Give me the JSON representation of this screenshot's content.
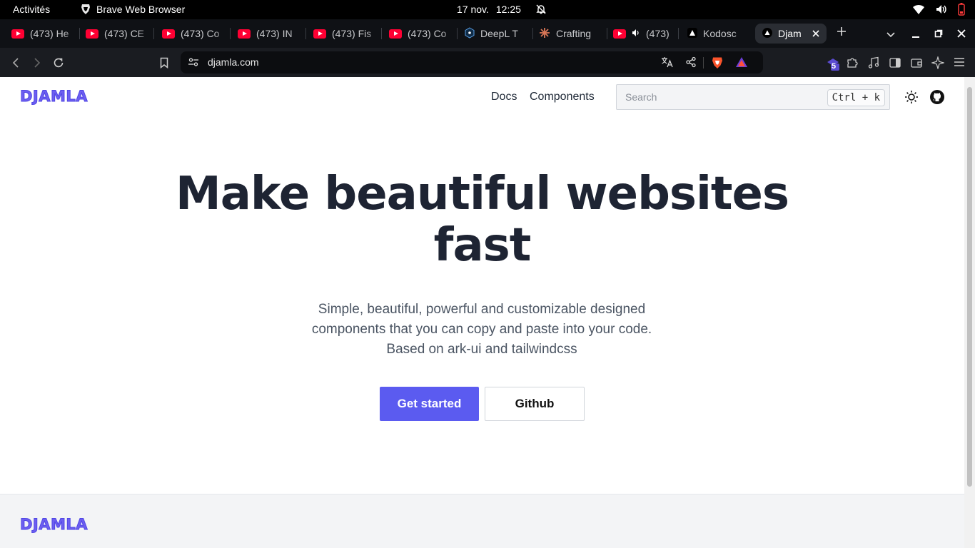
{
  "system_bar": {
    "activities": "Activités",
    "app_name": "Brave Web Browser",
    "date": "17 nov.",
    "time": "12:25"
  },
  "tabs": [
    {
      "label": "(473) He",
      "icon": "youtube-icon"
    },
    {
      "label": "(473) CE",
      "icon": "youtube-icon"
    },
    {
      "label": "(473) Co",
      "icon": "youtube-icon"
    },
    {
      "label": "(473) IN",
      "icon": "youtube-icon"
    },
    {
      "label": "(473) Fis",
      "icon": "youtube-icon"
    },
    {
      "label": "(473) Co",
      "icon": "youtube-icon"
    },
    {
      "label": "DeepL T",
      "icon": "deepl-icon"
    },
    {
      "label": "Crafting",
      "icon": "spark-icon"
    },
    {
      "label": "(473)",
      "icon": "youtube-icon"
    },
    {
      "label": "Kodosc",
      "icon": "triangle-icon"
    },
    {
      "label": "Djam",
      "icon": "triangle-icon",
      "active": true
    }
  ],
  "address_bar": {
    "url": "djamla.com",
    "extension_badge": "5"
  },
  "site": {
    "logo": "DJAMLA",
    "nav": {
      "docs": "Docs",
      "components": "Components"
    },
    "search": {
      "placeholder": "Search",
      "shortcut": "Ctrl + k"
    },
    "hero": {
      "title_line1": "Make beautiful websites",
      "title_line2": "fast",
      "subtitle_line1": "Simple, beautiful, powerful and customizable designed",
      "subtitle_line2": "components that you can copy and paste into your code.",
      "subtitle_line3": "Based on ark-ui and tailwindcss"
    },
    "buttons": {
      "primary": "Get started",
      "secondary": "Github"
    },
    "footer": {
      "logo": "DJAMLA"
    }
  },
  "colors": {
    "accent": "#5b5bf0",
    "heading": "#1e2433",
    "youtube": "#ff0033"
  }
}
